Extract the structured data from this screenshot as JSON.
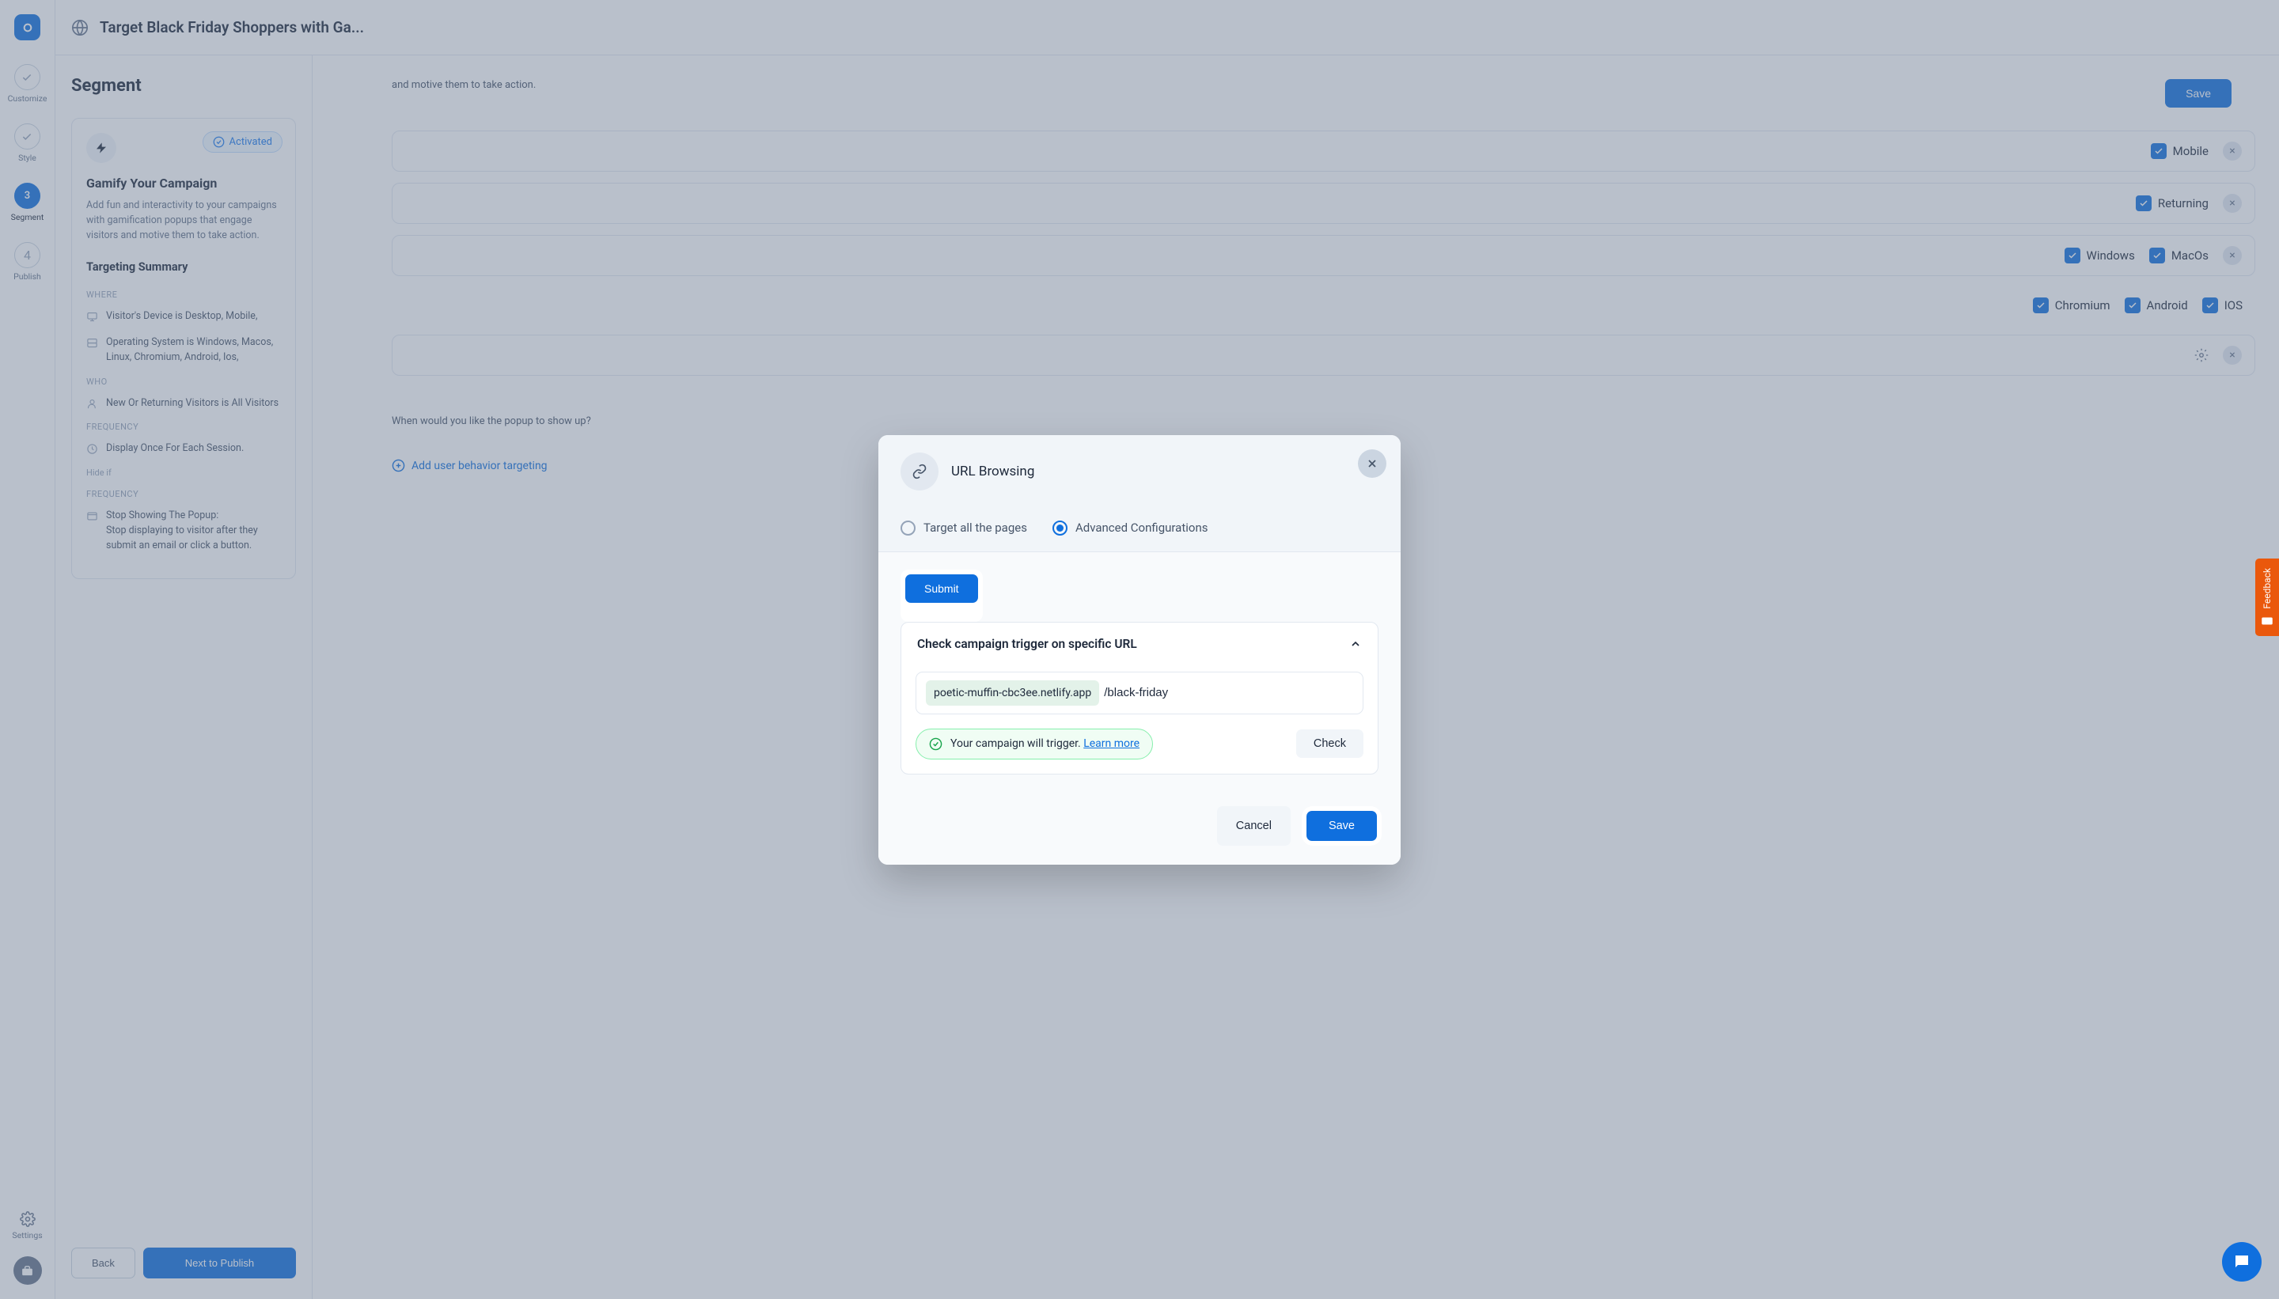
{
  "topbar": {
    "title": "Target Black Friday Shoppers with Ga..."
  },
  "rail": {
    "steps": [
      {
        "label": "Customize"
      },
      {
        "label": "Style"
      },
      {
        "num": "3",
        "label": "Segment"
      },
      {
        "num": "4",
        "label": "Publish"
      }
    ],
    "settings": "Settings"
  },
  "segment": {
    "title": "Segment",
    "activated": "Activated",
    "card_heading": "Gamify Your Campaign",
    "card_desc": "Add fun and interactivity to your campaigns with gamification popups that engage visitors and motive them to take action.",
    "summary_heading": "Targeting Summary",
    "where_label": "WHERE",
    "where_items": [
      "Visitor's Device is Desktop, Mobile,",
      "Operating System is Windows, Macos, Linux, Chromium, Android, Ios,"
    ],
    "who_label": "WHO",
    "who_item": "New Or Returning Visitors is All Visitors",
    "freq_label": "FREQUENCY",
    "freq_item": "Display Once For Each Session.",
    "hide_if": "Hide if",
    "freq2_label": "FREQUENCY",
    "freq2_item_a": "Stop Showing The Popup:",
    "freq2_item_b": "Stop displaying to visitor after they submit an email or click a button.",
    "back": "Back",
    "next": "Next to Publish"
  },
  "editor": {
    "save": "Save",
    "who_note": "and motive them to take action.",
    "opts": {
      "mobile": "Mobile",
      "returning": "Returning",
      "windows": "Windows",
      "macos": "MacOs",
      "chromium": "Chromium",
      "android": "Android",
      "ios": "IOS"
    },
    "when_q": "When would you like the popup to show up?",
    "add_behavior": "Add user behavior targeting"
  },
  "modal": {
    "title": "URL Browsing",
    "radio_all": "Target all the pages",
    "radio_adv": "Advanced Configurations",
    "submit": "Submit",
    "trigger_title": "Check campaign trigger on specific URL",
    "url_prefix": "poetic-muffin-cbc3ee.netlify.app",
    "url_path": "/black-friday",
    "status_text": "Your campaign will trigger.",
    "status_link": "Learn more",
    "check": "Check",
    "cancel": "Cancel",
    "save": "Save"
  },
  "feedback": "Feedback"
}
